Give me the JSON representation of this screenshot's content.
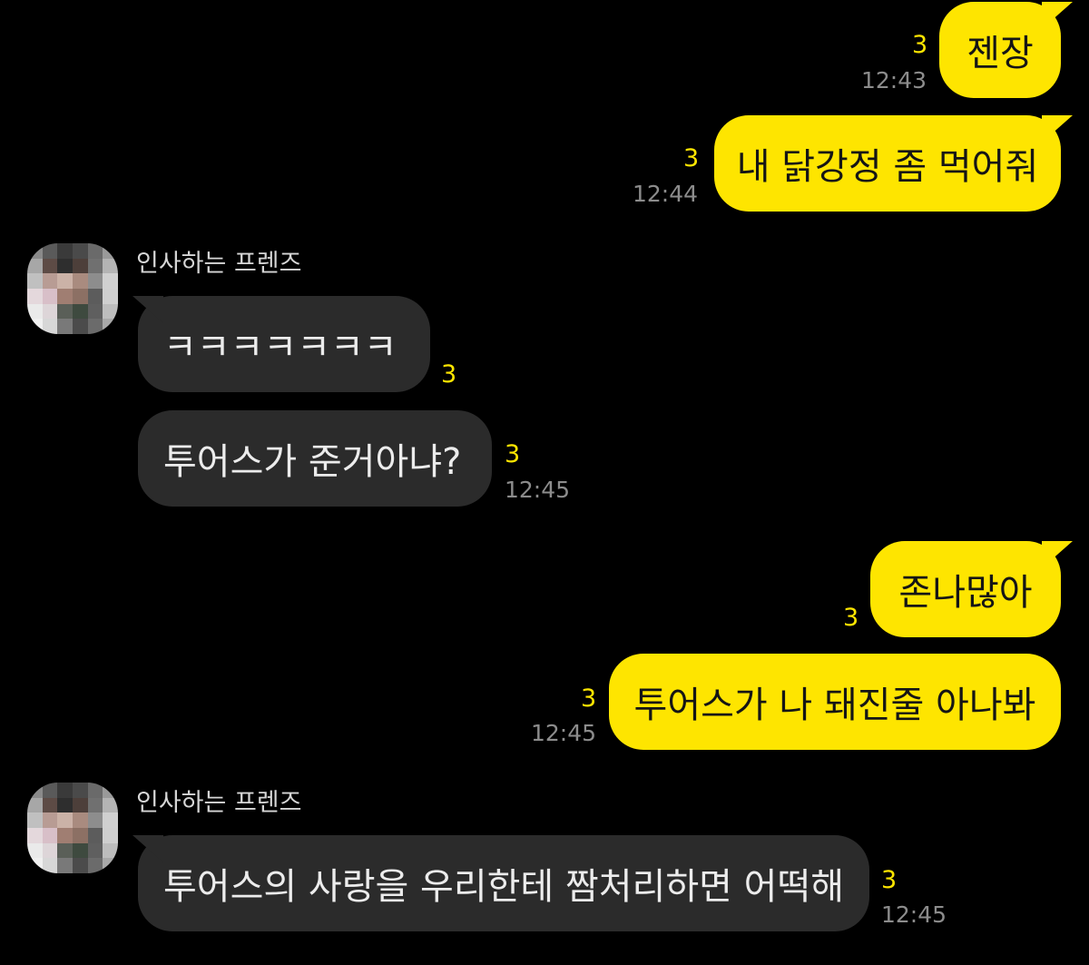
{
  "chat": {
    "messages": [
      {
        "from": "me",
        "text": "젠장",
        "unread": "3",
        "time": "12:43"
      },
      {
        "from": "me",
        "text": "내 닭강정 좀 먹어줘",
        "unread": "3",
        "time": "12:44"
      },
      {
        "from": "them",
        "sender": "인사하는 프렌즈",
        "text": "ㅋㅋㅋㅋㅋㅋㅋ",
        "unread": "3"
      },
      {
        "from": "them",
        "text": "투어스가 준거아냐?",
        "unread": "3",
        "time": "12:45"
      },
      {
        "from": "me",
        "text": "존나많아",
        "unread": "3"
      },
      {
        "from": "me",
        "text": "투어스가 나 돼진줄 아나봐",
        "unread": "3",
        "time": "12:45"
      },
      {
        "from": "them",
        "sender": "인사하는 프렌즈",
        "text": "투어스의 사랑을 우리한테 짬처리하면 어떡해",
        "unread": "3",
        "time": "12:45"
      }
    ]
  },
  "colors": {
    "background": "#000000",
    "my_bubble": "#fee500",
    "their_bubble": "#2b2b2b",
    "unread_count": "#fee500",
    "timestamp": "#8c8c8c"
  },
  "icons": {
    "avatar": "pixelated-profile-avatar"
  }
}
